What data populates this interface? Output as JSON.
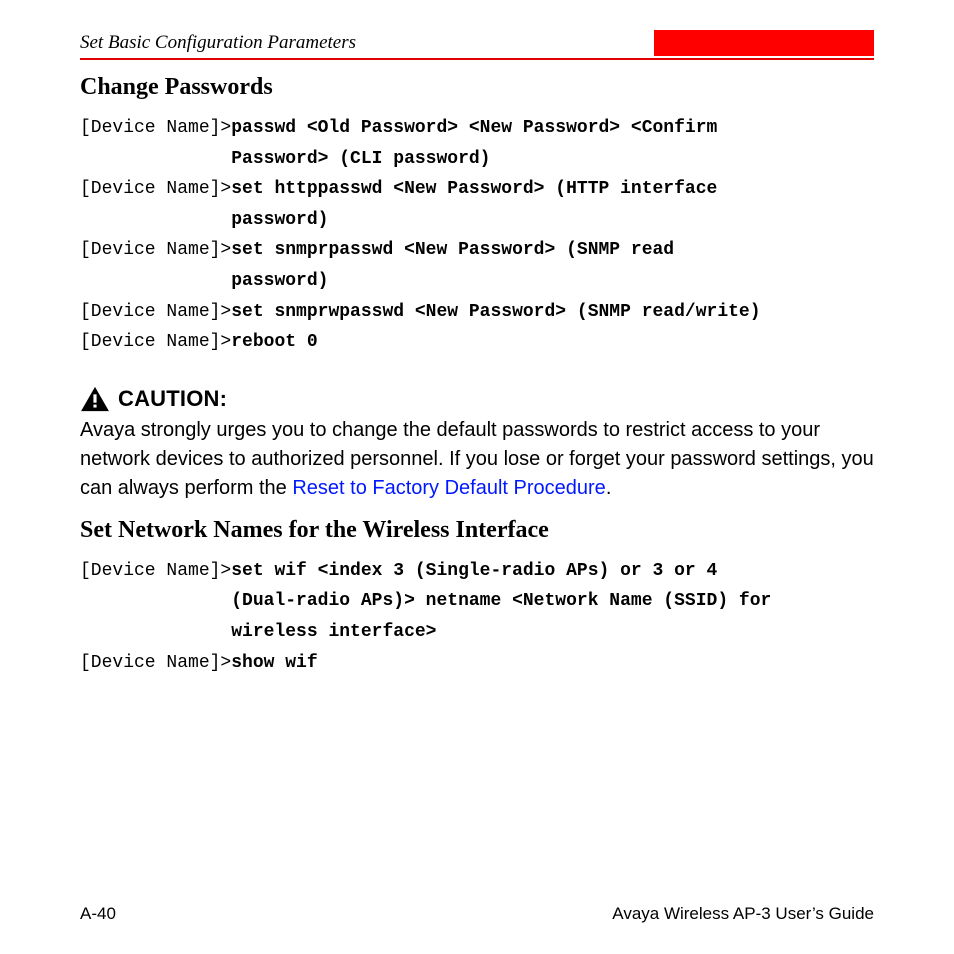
{
  "header": {
    "title": "Set Basic Configuration Parameters"
  },
  "section1": {
    "heading": "Change Passwords",
    "prompt": "[Device Name]>",
    "lines": [
      {
        "cmd": "passwd <Old Password> <New Password> <Confirm"
      },
      {
        "cont": true,
        "cmd": "Password> (CLI password)"
      },
      {
        "cmd": "set httppasswd <New Password> (HTTP interface"
      },
      {
        "cont": true,
        "cmd": "password)"
      },
      {
        "cmd": "set snmprpasswd <New Password> (SNMP read"
      },
      {
        "cont": true,
        "cmd": "password)"
      },
      {
        "cmd": "set snmprwpasswd <New Password> (SNMP read/write)"
      },
      {
        "cmd": "reboot 0"
      }
    ]
  },
  "caution": {
    "label": "CAUTION:",
    "body_pre": "Avaya strongly urges you to change the default passwords to restrict access to your network devices to authorized personnel. If you lose or forget your password settings, you can always perform the ",
    "link": "Reset to Factory Default Procedure",
    "body_post": "."
  },
  "section2": {
    "heading": "Set Network Names for the Wireless Interface",
    "prompt": "[Device Name]>",
    "lines": [
      {
        "cmd": "set wif <index 3 (Single-radio APs) or 3 or 4"
      },
      {
        "cont": true,
        "cmd": "(Dual-radio APs)> netname <Network Name (SSID) for"
      },
      {
        "cont": true,
        "cmd": "wireless interface>"
      },
      {
        "cmd": "show wif"
      }
    ]
  },
  "footer": {
    "left": "A-40",
    "right": "Avaya Wireless AP-3 User’s Guide"
  }
}
